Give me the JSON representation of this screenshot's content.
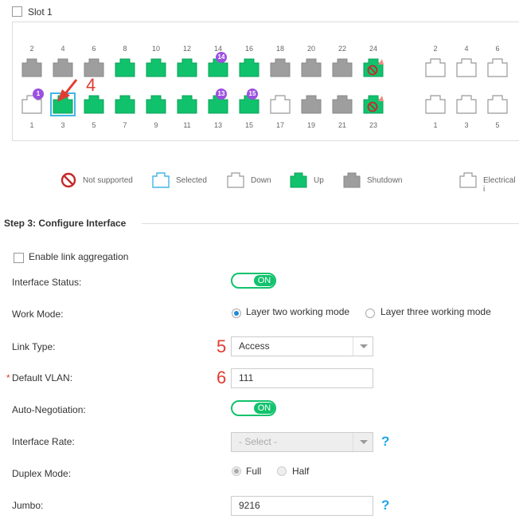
{
  "slot": {
    "label": "Slot 1"
  },
  "ports": {
    "top": [
      {
        "num": "2",
        "state": "shutdown"
      },
      {
        "num": "4",
        "state": "shutdown"
      },
      {
        "num": "6",
        "state": "shutdown"
      },
      {
        "num": "8",
        "state": "up"
      },
      {
        "num": "10",
        "state": "up"
      },
      {
        "num": "12",
        "state": "up"
      },
      {
        "num": "14",
        "state": "up",
        "badge": "14"
      },
      {
        "num": "16",
        "state": "up"
      },
      {
        "num": "18",
        "state": "shutdown"
      },
      {
        "num": "20",
        "state": "shutdown"
      },
      {
        "num": "22",
        "state": "shutdown"
      },
      {
        "num": "24",
        "state": "notsupported"
      }
    ],
    "bottom": [
      {
        "num": "1",
        "state": "down",
        "badge": "1"
      },
      {
        "num": "3",
        "state": "selected"
      },
      {
        "num": "5",
        "state": "up"
      },
      {
        "num": "7",
        "state": "up"
      },
      {
        "num": "9",
        "state": "up"
      },
      {
        "num": "11",
        "state": "up"
      },
      {
        "num": "13",
        "state": "up",
        "badge": "13"
      },
      {
        "num": "15",
        "state": "up",
        "badge": "15"
      },
      {
        "num": "17",
        "state": "down"
      },
      {
        "num": "19",
        "state": "shutdown"
      },
      {
        "num": "21",
        "state": "shutdown"
      },
      {
        "num": "23",
        "state": "notsupported"
      }
    ],
    "ext_top": [
      {
        "num": "2"
      },
      {
        "num": "4"
      },
      {
        "num": "6"
      }
    ],
    "ext_bottom": [
      {
        "num": "1"
      },
      {
        "num": "3"
      },
      {
        "num": "5"
      }
    ]
  },
  "legend": {
    "not_supported": "Not supported",
    "selected": "Selected",
    "down": "Down",
    "up": "Up",
    "shutdown": "Shutdown",
    "electrical": "Electrical i"
  },
  "section": {
    "title": "Step 3: Configure Interface"
  },
  "form": {
    "link_aggregation": "Enable link aggregation",
    "interface_status": {
      "label": "Interface Status:",
      "toggle": "ON"
    },
    "work_mode": {
      "label": "Work Mode:",
      "option1": "Layer two working mode",
      "option2": "Layer three working mode"
    },
    "link_type": {
      "label": "Link Type:",
      "value": "Access"
    },
    "default_vlan": {
      "required": "*",
      "label": "Default VLAN:",
      "value": "111"
    },
    "auto_negotiation": {
      "label": "Auto-Negotiation:",
      "toggle": "ON"
    },
    "interface_rate": {
      "label": "Interface Rate:",
      "placeholder": "- Select -",
      "help": "?"
    },
    "duplex_mode": {
      "label": "Duplex Mode:",
      "option1": "Full",
      "option2": "Half"
    },
    "jumbo": {
      "label": "Jumbo:",
      "value": "9216",
      "help": "?"
    }
  },
  "annotations": {
    "mark4": "4",
    "mark5": "5",
    "mark6": "6"
  },
  "colors": {
    "up": "#11c26d",
    "shutdown": "#9e9e9e",
    "selected_border": "#41b6e6",
    "badge": "#9b51e0",
    "accent": "#1c8ad9"
  }
}
